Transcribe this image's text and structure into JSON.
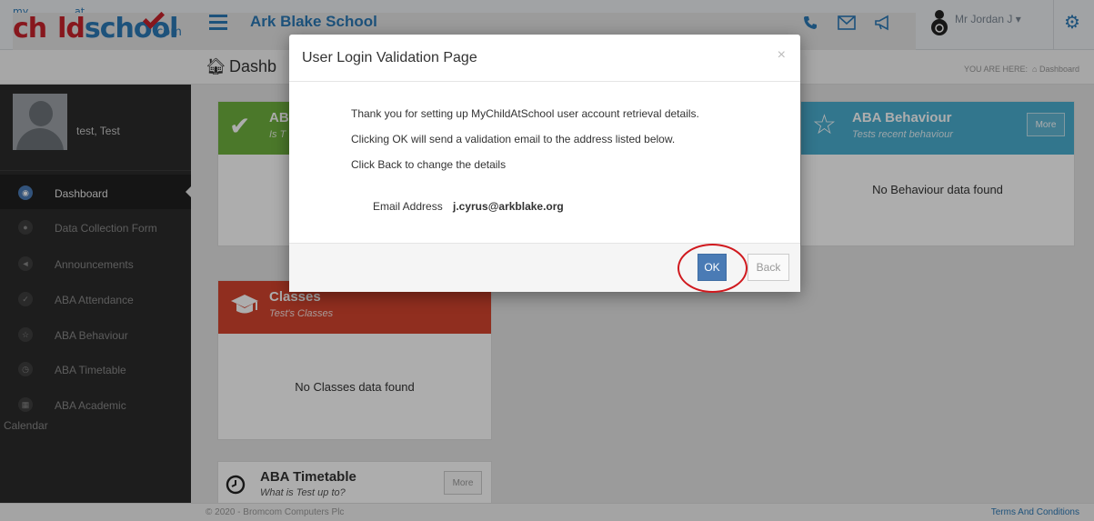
{
  "header": {
    "logo": {
      "my": "my",
      "at": "at",
      "child": "ch",
      "child2": "ld",
      "school": "school",
      "dotcom": ".com"
    },
    "school_name": "Ark Blake School",
    "user_name": "Mr Jordan J",
    "icons": [
      "phone-icon",
      "mail-icon",
      "megaphone-icon",
      "user-icon",
      "gear-icon"
    ]
  },
  "subheader": {
    "title": "Dashb",
    "you_are_here": "YOU ARE HERE:",
    "crumb": "Dashboard"
  },
  "sidebar": {
    "profile_name": "test, Test",
    "items": [
      {
        "label": "Dashboard",
        "icon": "dashboard-icon"
      },
      {
        "label": "Data Collection Form",
        "icon": "user-icon"
      },
      {
        "label": "Announcements",
        "icon": "megaphone-icon"
      },
      {
        "label": "ABA Attendance",
        "icon": "check-icon"
      },
      {
        "label": "ABA Behaviour",
        "icon": "star-icon"
      },
      {
        "label": "ABA Timetable",
        "icon": "clock-icon"
      },
      {
        "label": "ABA Academic",
        "icon": "calendar-icon"
      }
    ],
    "calendar_suffix": "Calendar"
  },
  "cards": {
    "attendance": {
      "title": "AB",
      "subtitle": "Is T"
    },
    "behaviour": {
      "title": "ABA Behaviour",
      "subtitle": "Tests recent behaviour",
      "more": "More",
      "empty": "No Behaviour data found"
    },
    "classes": {
      "title": "Classes",
      "subtitle": "Test's Classes",
      "empty": "No Classes data found"
    },
    "timetable": {
      "title": "ABA Timetable",
      "subtitle": "What is Test up to?",
      "more": "More"
    }
  },
  "modal": {
    "title": "User Login Validation Page",
    "close": "×",
    "line1": "Thank you for setting up MyChildAtSchool user account retrieval details.",
    "line2": "Clicking OK will send a validation email to the address listed below.",
    "line3": "Click Back to change the details",
    "email_label": "Email Address",
    "email_value": "j.cyrus@arkblake.org",
    "ok": "OK",
    "back": "Back"
  },
  "footer": {
    "copyright": "© 2020 - Bromcom Computers Plc",
    "terms": "Terms And Conditions"
  },
  "colors": {
    "brand_blue": "#2c79b6",
    "brand_red": "#c8232c",
    "attendance_green": "#6fb23e",
    "behaviour_teal": "#4aaed0",
    "classes_red": "#d4452f",
    "ok_button": "#4a7bb5",
    "highlight_circle": "#d0191e"
  }
}
